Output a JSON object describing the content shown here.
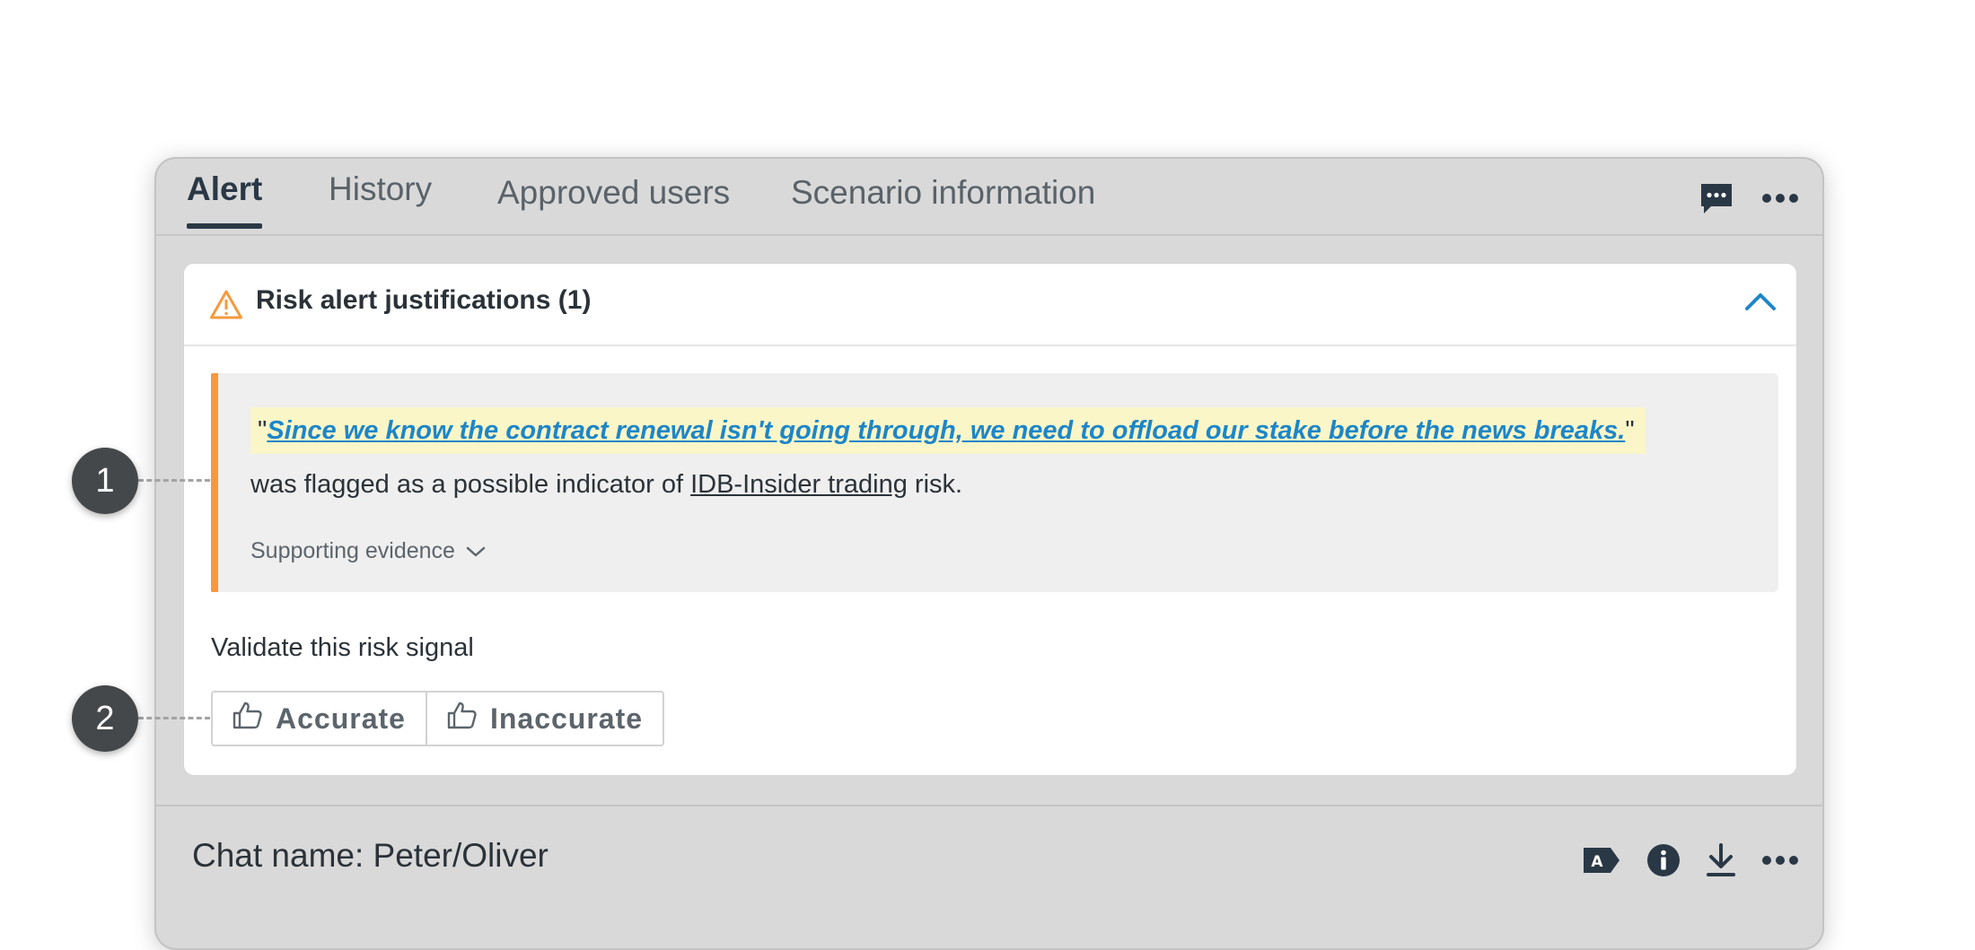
{
  "tabs": [
    {
      "label": "Alert",
      "active": true
    },
    {
      "label": "History",
      "active": false
    },
    {
      "label": "Approved users",
      "active": false
    },
    {
      "label": "Scenario information",
      "active": false
    }
  ],
  "top_icons": [
    "chat-icon",
    "more-icon"
  ],
  "card": {
    "title": "Risk alert justifications (1)",
    "collapse_icon": "chevron-up-icon",
    "justification": {
      "open_quote": "\"",
      "quote": "Since we know the contract renewal isn't going through, we need to offload our stake before the news breaks.",
      "close_quote": "\"",
      "flag_prefix": "was flagged as a possible indicator of ",
      "risk_name": "IDB-Insider trading",
      "flag_suffix": " risk.",
      "evidence_label": "Supporting evidence"
    },
    "validate_label": "Validate this risk signal",
    "accurate_label": "Accurate",
    "inaccurate_label": "Inaccurate"
  },
  "chat": {
    "name": "Chat name: Peter/Oliver",
    "icons": [
      "label-icon",
      "info-icon",
      "download-icon",
      "more-icon"
    ]
  },
  "callouts": [
    "1",
    "2"
  ],
  "colors": {
    "accent_orange": "#f6993c",
    "link_blue": "#1d86c8",
    "highlight_yellow": "#fbf6c8",
    "tab_active": "#2a3846"
  }
}
